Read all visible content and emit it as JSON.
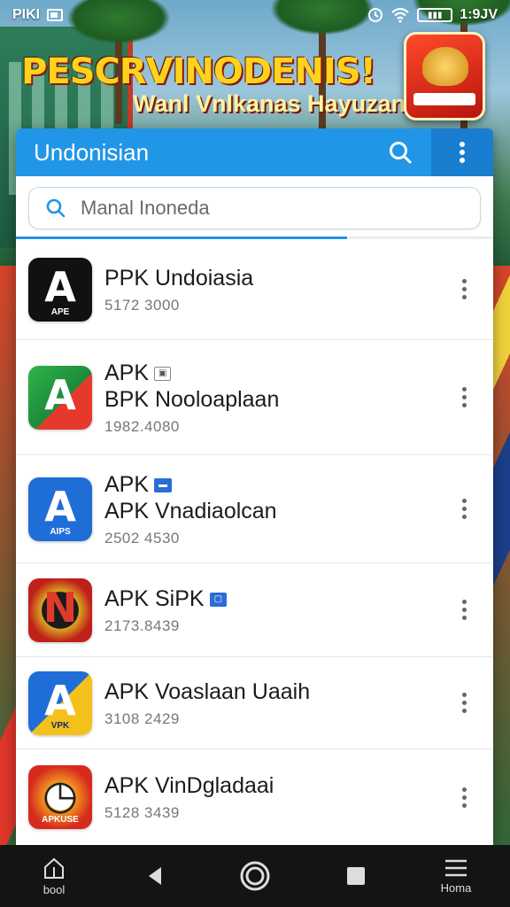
{
  "status_bar": {
    "left_text": "PIKI",
    "time": "1:9JV"
  },
  "banner": {
    "title": "PESCRVINODENIS!",
    "subtitle": "Wanl Vnlkanas Hayuzan"
  },
  "card": {
    "title": "Undonisian",
    "search": {
      "placeholder": "Manal Inoneda"
    }
  },
  "apps": [
    {
      "line1": "PPK Undoiasia",
      "line2": "",
      "meta": "5172 3000",
      "icon_glyph": "A",
      "icon_sub": "APE"
    },
    {
      "line1": "APK",
      "line2": "BPK Nooloaplaan",
      "meta": "1982.4080",
      "icon_glyph": "A",
      "icon_sub": ""
    },
    {
      "line1": "APK",
      "line2": "APK Vnadiaolcan",
      "meta": "2502 4530",
      "icon_glyph": "A",
      "icon_sub": "AIPS"
    },
    {
      "line1": "APK SiPK",
      "line2": "",
      "meta": "2173.8439",
      "icon_glyph": "N",
      "icon_sub": ""
    },
    {
      "line1": "APK Voaslaan Uaaih",
      "line2": "",
      "meta": "3108 2429",
      "icon_glyph": "A",
      "icon_sub": "VPK"
    },
    {
      "line1": "APK VinDgladaai",
      "line2": "",
      "meta": "5128 3439",
      "icon_glyph": "◷",
      "icon_sub": "APKUSE"
    }
  ],
  "navbar": {
    "left_label": "bool",
    "right_label": "Homa"
  },
  "colors": {
    "appbar": "#2196e6",
    "appbar_more": "#1a7ed0",
    "navbar": "#141414"
  }
}
